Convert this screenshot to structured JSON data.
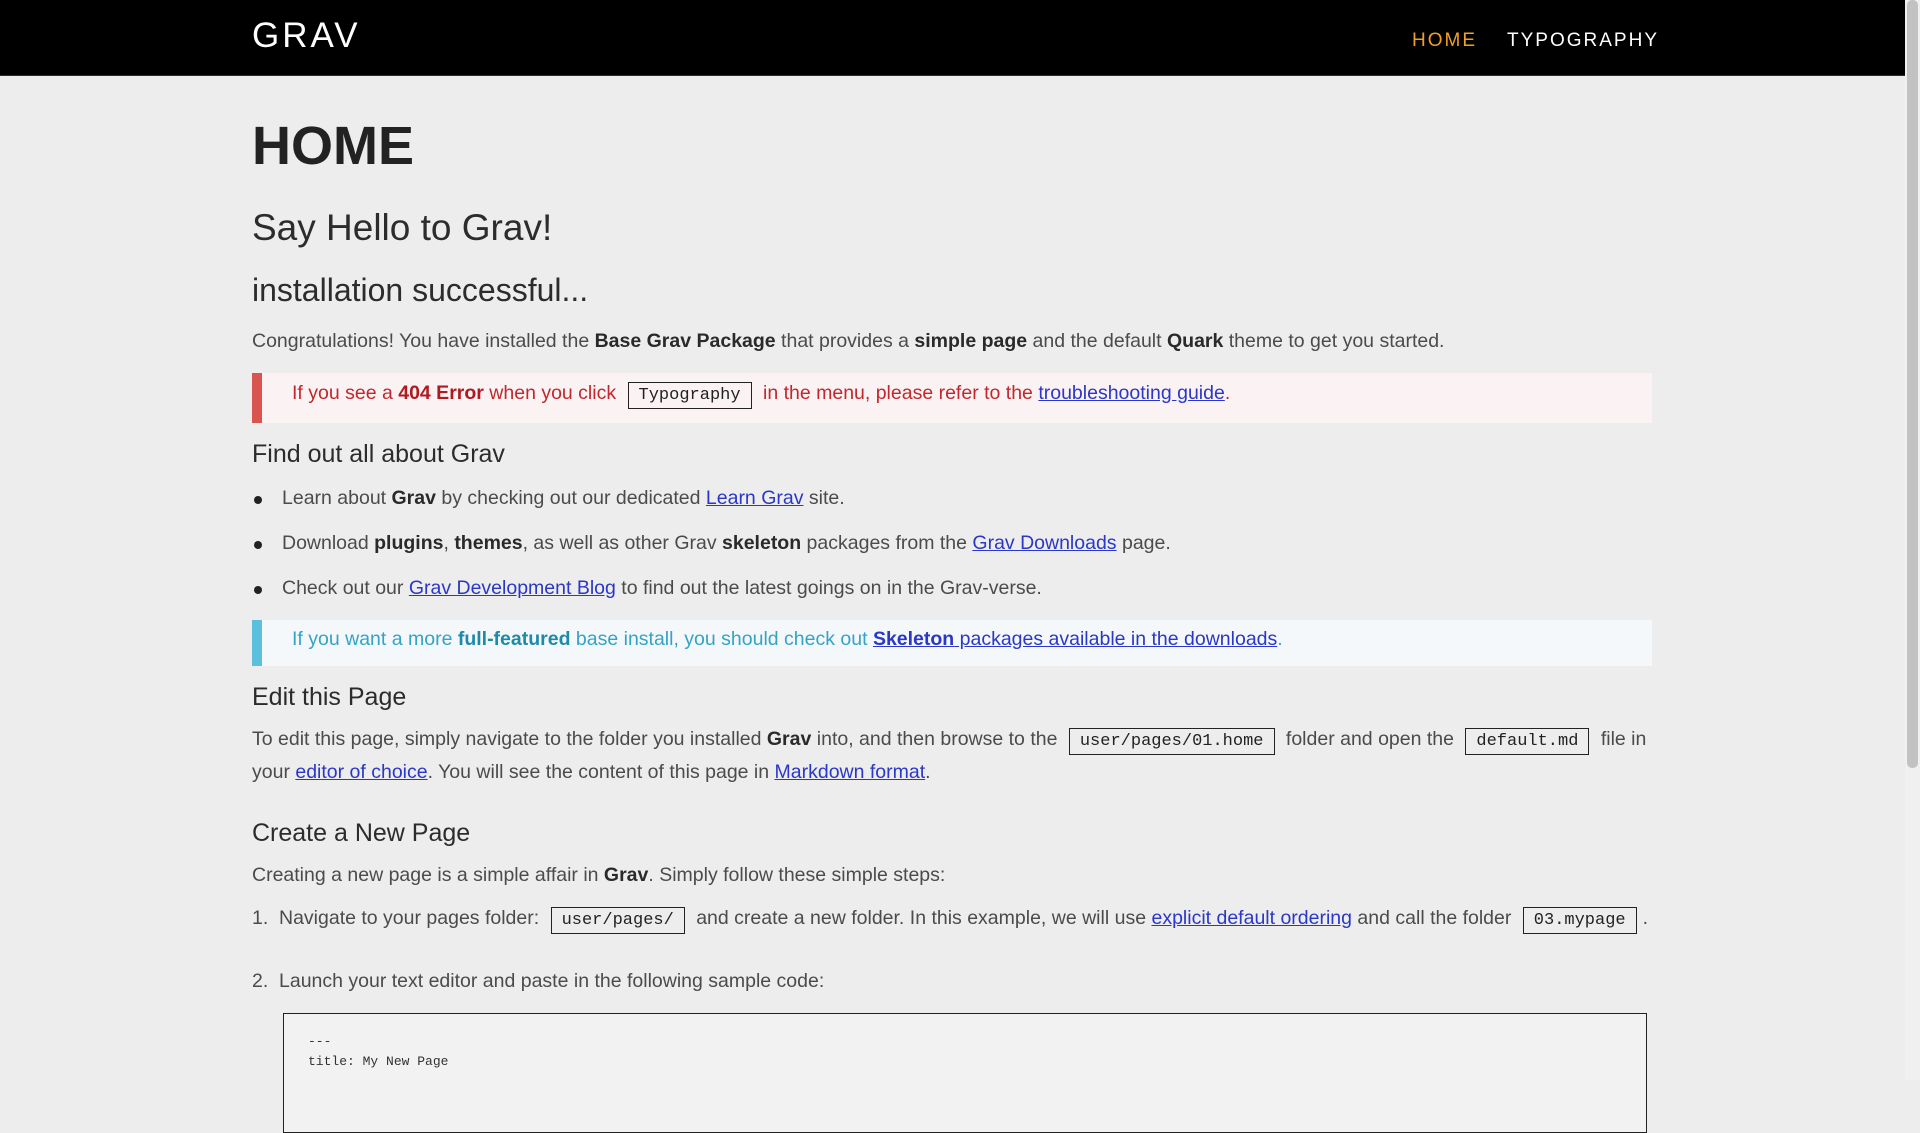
{
  "header": {
    "logo": "GRAV",
    "nav": [
      "HOME",
      "TYPOGRAPHY"
    ],
    "active_color": "#f0a024"
  },
  "page": {
    "title": "HOME",
    "h_hello": "Say Hello to Grav!",
    "h_install": "installation successful...",
    "intro": {
      "p1": "Congratulations! You have installed the ",
      "b1": "Base Grav Package",
      "p2": " that provides a ",
      "b2": "simple page",
      "p3": " and the default ",
      "b3": "Quark",
      "p4": " theme to get you started."
    },
    "notice_red": {
      "p1": "If you see a ",
      "b1": "404 Error",
      "p2": " when you click ",
      "code": "Typography",
      "p3": " in the menu, please refer to the ",
      "link": "troubleshooting guide",
      "p4": "."
    },
    "find_heading": "Find out all about Grav",
    "bullets": {
      "b1": {
        "p1": "Learn about ",
        "b1": "Grav",
        "p2": " by checking out our dedicated ",
        "link": "Learn Grav",
        "p3": " site."
      },
      "b2": {
        "p1": "Download ",
        "b1": "plugins",
        "p2": ", ",
        "b2": "themes",
        "p3": ", as well as other Grav ",
        "b3": "skeleton",
        "p4": " packages from the ",
        "link": "Grav Downloads",
        "p5": " page."
      },
      "b3": {
        "p1": "Check out our ",
        "link": "Grav Development Blog",
        "p2": " to find out the latest goings on in the Grav-verse."
      }
    },
    "notice_blue": {
      "p1": "If you want a more ",
      "b1": "full-featured",
      "p2": " base install, you should check out ",
      "link_b": "Skeleton",
      "link": " packages available in the downloads",
      "p3": "."
    },
    "edit_heading": "Edit this Page",
    "edit": {
      "p1": "To edit this page, simply navigate to the folder you installed ",
      "b1": "Grav",
      "p2": " into, and then browse to the ",
      "code1": "user/pages/01.home",
      "p3": " folder and open the ",
      "code2": "default.md",
      "p4": " file in your ",
      "link1": "editor of choice",
      "p5": ". You will see the content of this page in ",
      "link2": "Markdown format",
      "p6": "."
    },
    "create_heading": "Create a New Page",
    "create": {
      "p1": "Creating a new page is a simple affair in ",
      "b1": "Grav",
      "p2": ". Simply follow these simple steps:"
    },
    "steps": {
      "s1": {
        "num": "1.",
        "p1": "Navigate to your pages folder: ",
        "code1": "user/pages/",
        "p2": " and create a new folder. In this example, we will use ",
        "link": "explicit default ordering",
        "p3": " and call the folder ",
        "code2": "03.mypage",
        "p4": "."
      },
      "s2": {
        "num": "2.",
        "p1": "Launch your text editor and paste in the following sample code:"
      }
    },
    "code_sample": "---\ntitle: My New Page"
  }
}
